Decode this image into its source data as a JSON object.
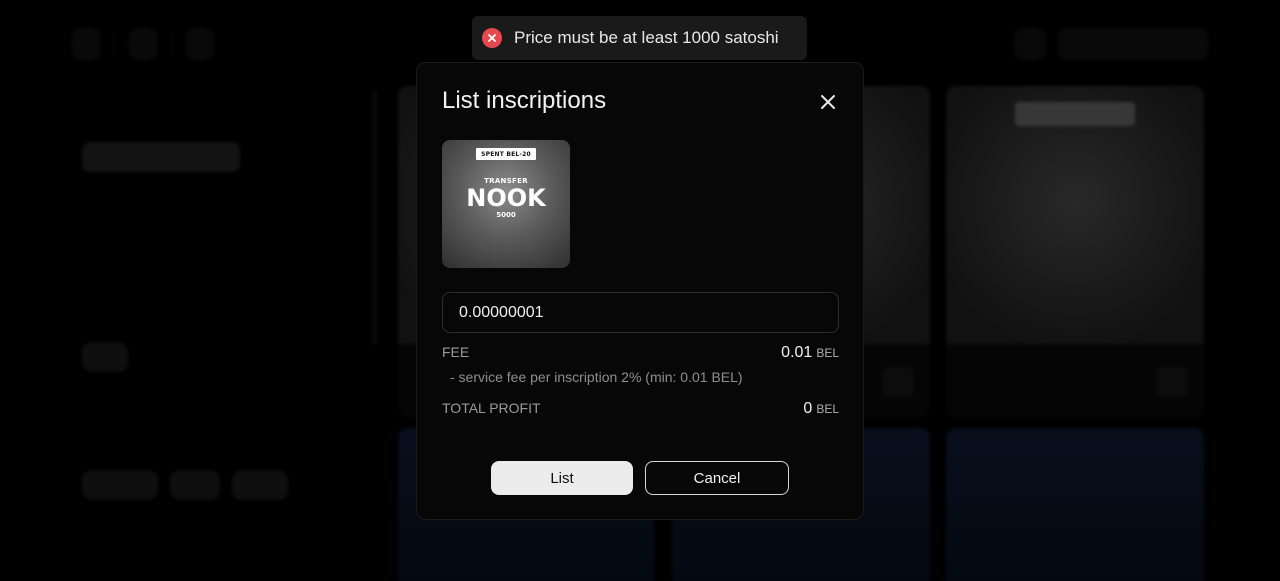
{
  "toast": {
    "icon": "error-circle-icon",
    "message": "Price must be at least 1000 satoshi",
    "color": "#e5484d"
  },
  "modal": {
    "title": "List inscriptions",
    "inscription": {
      "badge": "SPENT BEL-20",
      "label": "TRANSFER",
      "ticker": "NOOK",
      "amount": "5000"
    },
    "price_value": "0.00000001",
    "fee": {
      "label": "FEE",
      "value": "0.01",
      "unit": "BEL"
    },
    "fee_note": "- service fee per inscription 2% (min: 0.01 BEL)",
    "total": {
      "label": "TOTAL PROFIT",
      "value": "0",
      "unit": "BEL"
    },
    "list_button": "List",
    "cancel_button": "Cancel"
  }
}
